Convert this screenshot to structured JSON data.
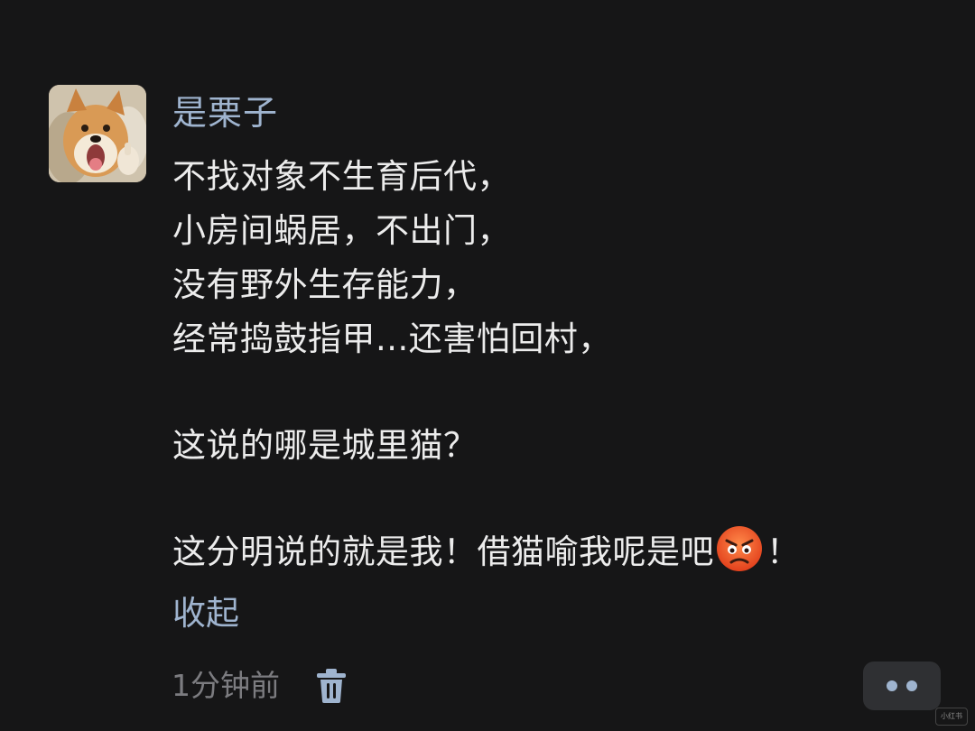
{
  "comment": {
    "username": "是栗子",
    "lines": [
      "不找对象不生育后代，",
      "小房间蜗居，不出门，",
      "没有野外生存能力，",
      "经常捣鼓指甲...还害怕回村，",
      "这说的哪是城里猫？",
      "这分明说的就是我！借猫喻我呢是吧",
      "！"
    ],
    "emoji": "angry-face-emoji",
    "collapse_label": "收起",
    "time": "1分钟前"
  },
  "icons": {
    "delete": "trash-icon",
    "more": "more-dots-icon"
  },
  "watermark": "小红书",
  "colors": {
    "background": "#161617",
    "username": "#9fb4cf",
    "text": "#ececec",
    "muted": "#7c7c80",
    "button_bg": "#2f3033"
  }
}
